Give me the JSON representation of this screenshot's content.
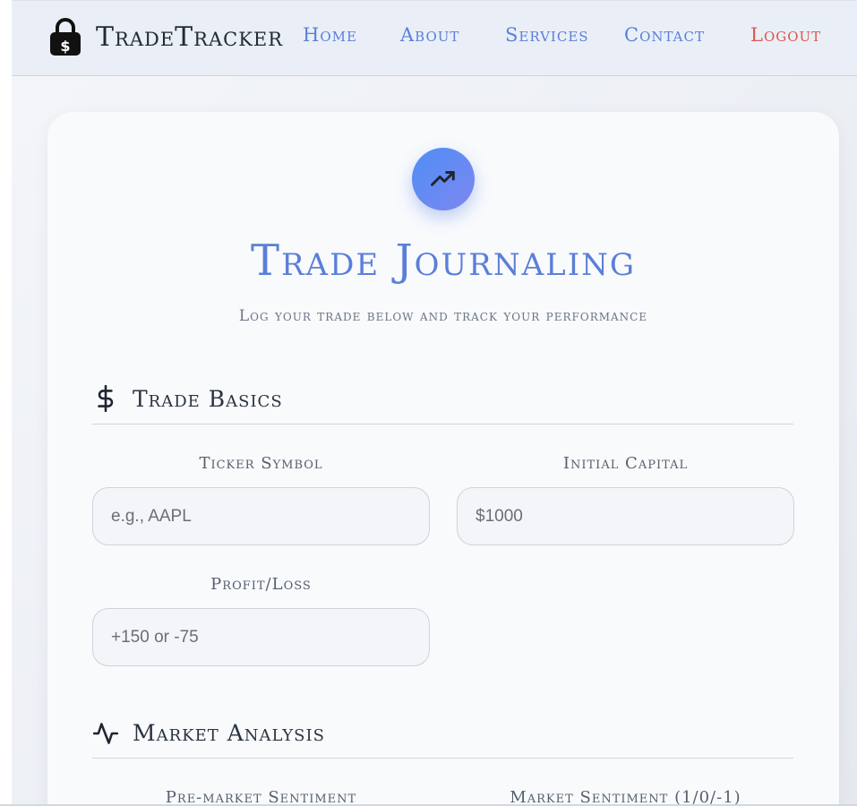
{
  "nav": {
    "brand": "TradeTracker",
    "links": [
      "Home",
      "About",
      "Services",
      "Contact"
    ],
    "logout": "Logout"
  },
  "header": {
    "title": "Trade Journaling",
    "subtitle": "Log your trade below and track your performance"
  },
  "sections": {
    "basics": {
      "title": "Trade Basics",
      "ticker_label": "Ticker Symbol",
      "ticker_placeholder": "e.g., AAPL",
      "capital_label": "Initial Capital",
      "capital_placeholder": "$1000",
      "pl_label": "Profit/Loss",
      "pl_placeholder": "+150 or -75"
    },
    "analysis": {
      "title": "Market Analysis",
      "premarket_label": "Pre-market Sentiment",
      "sentiment_label": "Market Sentiment (1/0/-1)"
    }
  },
  "colors": {
    "accent": "#5b7fd8",
    "logout": "#e0554f",
    "hero_gradient_start": "#4f8ef5",
    "hero_gradient_end": "#7d87f0"
  },
  "icons": {
    "brand": "lock-dollar-icon",
    "hero": "trending-up-icon",
    "basics": "dollar-icon",
    "analysis": "activity-icon"
  }
}
